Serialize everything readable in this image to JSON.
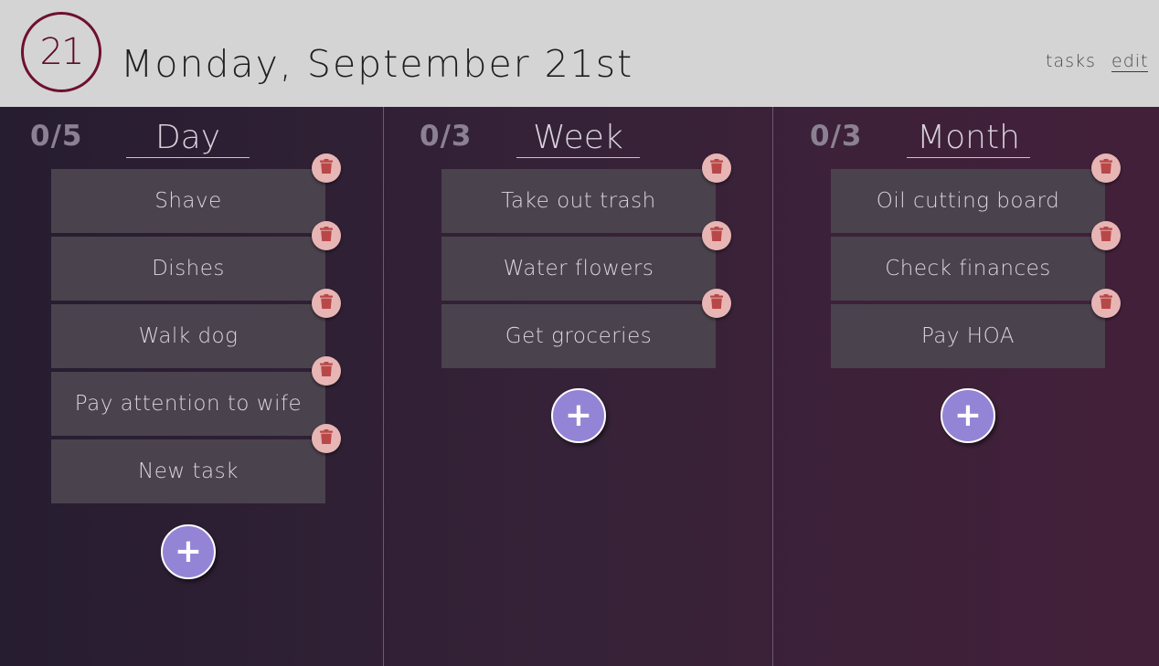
{
  "header": {
    "day_number": "21",
    "date_title": "Monday, September 21st",
    "nav": {
      "tasks": "tasks",
      "edit": "edit"
    }
  },
  "columns": [
    {
      "title": "Day",
      "count": "0/5",
      "tasks": [
        "Shave",
        "Dishes",
        "Walk dog",
        "Pay attention to wife",
        "New task"
      ]
    },
    {
      "title": "Week",
      "count": "0/3",
      "tasks": [
        "Take out trash",
        "Water flowers",
        "Get groceries"
      ]
    },
    {
      "title": "Month",
      "count": "0/3",
      "tasks": [
        "Oil cutting board",
        "Check finances",
        "Pay HOA"
      ]
    }
  ],
  "icons": {
    "delete": "trash-icon",
    "add": "plus-icon"
  },
  "colors": {
    "header_bg": "#d4d4d4",
    "accent": "#6e1030",
    "task_bg": "#4a424d",
    "trash_bg": "#e8b5b5",
    "trash_icon": "#b84848",
    "add_bg": "#9484d6"
  }
}
